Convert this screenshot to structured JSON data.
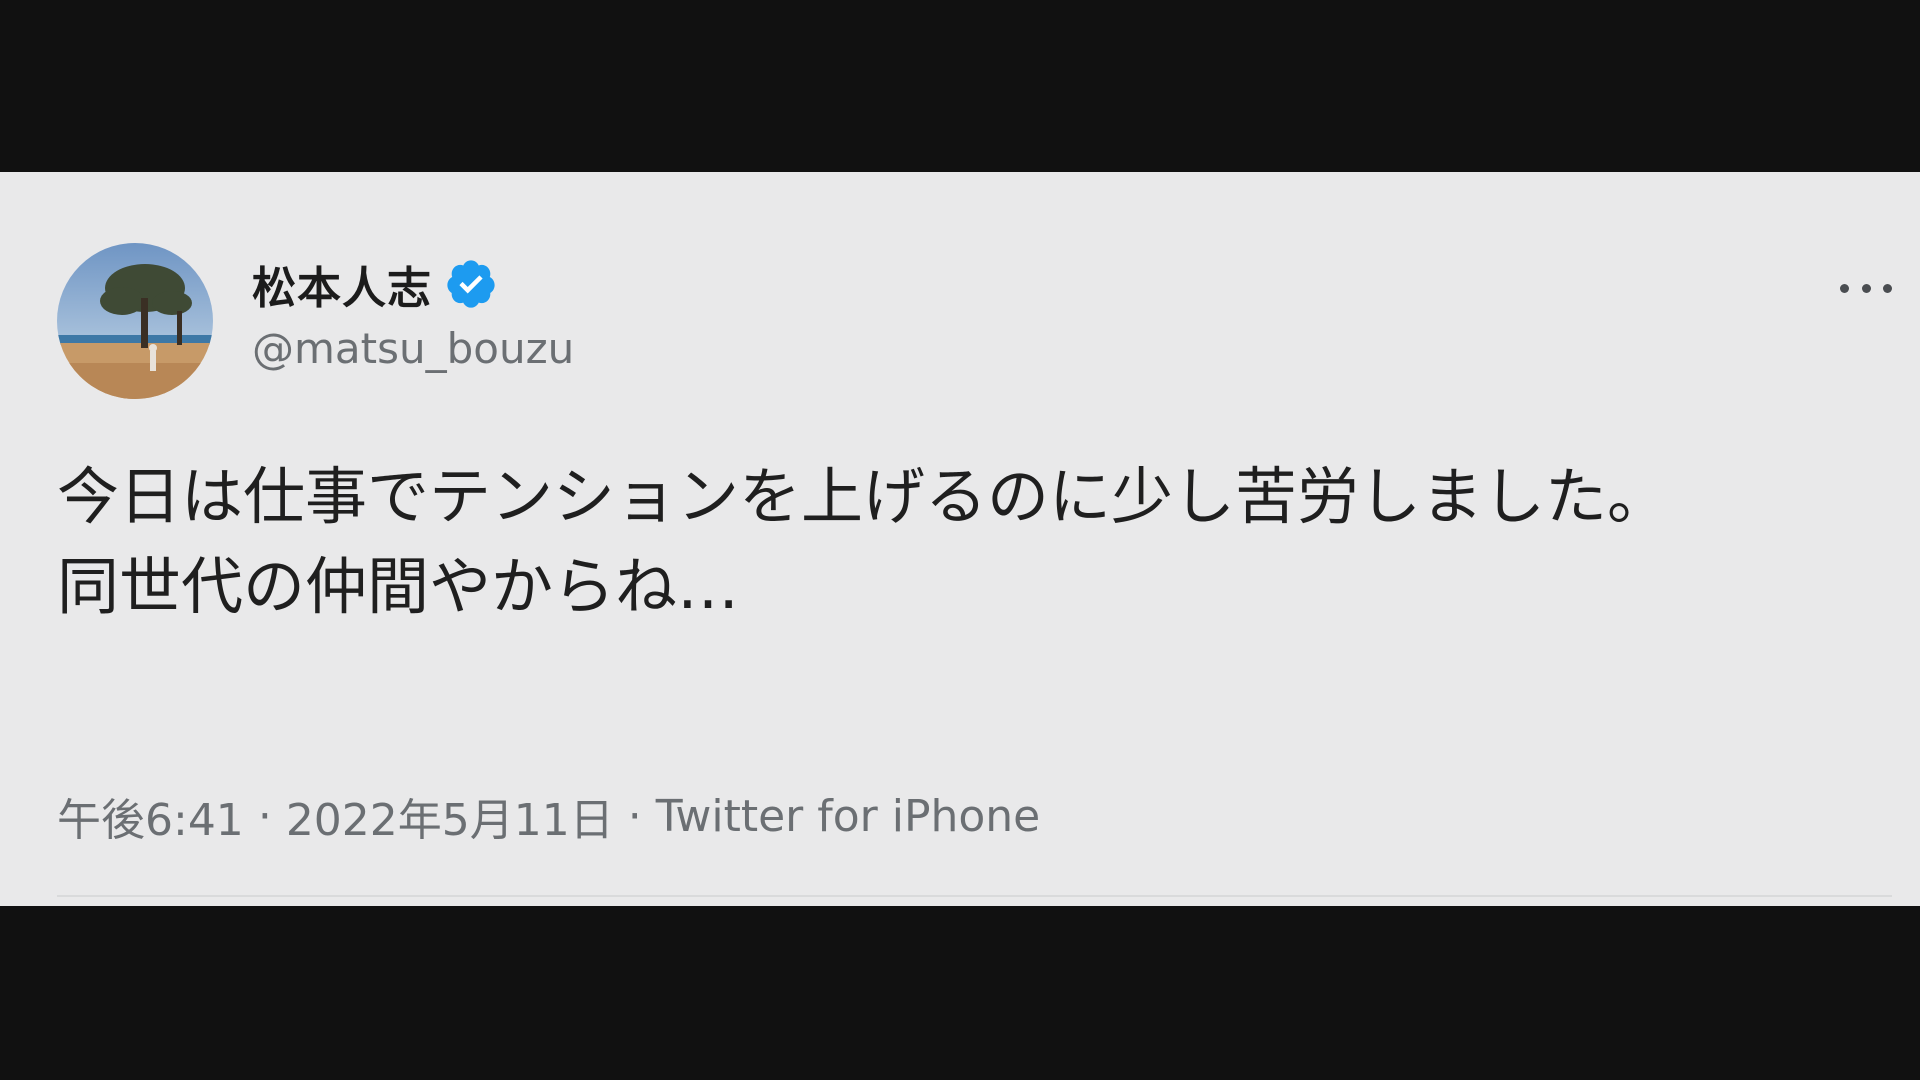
{
  "tweet": {
    "display_name": "松本人志",
    "handle": "@matsu_bouzu",
    "text": "今日は仕事でテンションを上げるのに少し苦労しました。\n同世代の仲間やからね…",
    "time": "午後6:41",
    "date": "2022年5月11日",
    "source": "Twitter for iPhone",
    "separator": "·"
  },
  "icons": {
    "verified": "verified-badge-icon",
    "more": "more-options-icon"
  },
  "colors": {
    "card_background": "#e9e9ea",
    "verified_blue": "#1d9bf0",
    "name_text": "#1c1c1c",
    "secondary_text": "#6b6f73"
  }
}
